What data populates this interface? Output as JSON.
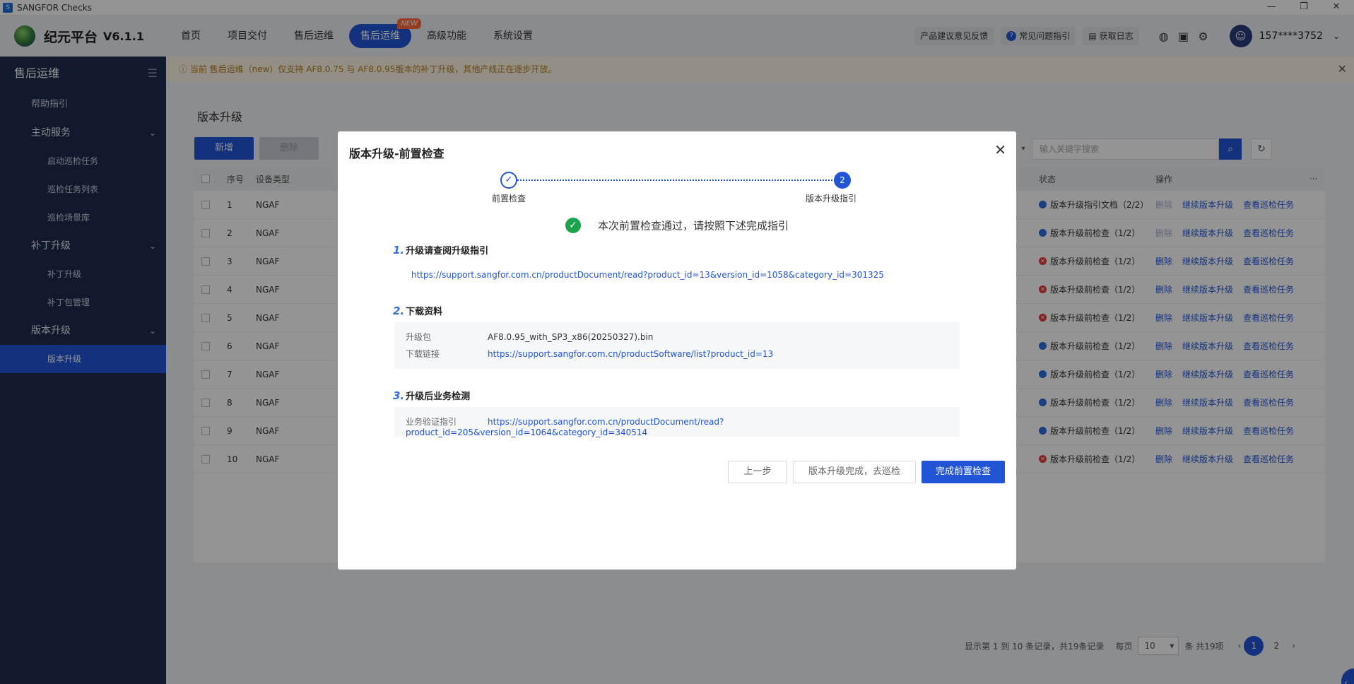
{
  "window": {
    "title": "SANGFOR Checks",
    "min": "—",
    "restore": "❐",
    "close": "✕",
    "app_icon": "S"
  },
  "topnav": {
    "brand": "纪元平台",
    "version": "V6.1.1",
    "items": [
      {
        "label": "首页"
      },
      {
        "label": "项目交付"
      },
      {
        "label": "售后运维"
      },
      {
        "label": "售后运维",
        "badge": "NEW"
      },
      {
        "label": "高级功能"
      },
      {
        "label": "系统设置"
      }
    ],
    "feedback": "产品建议意见反馈",
    "faq": "常见问题指引",
    "faq_icon_glyph": "?",
    "log": "获取日志",
    "log_icon_glyph": "▤",
    "globe_glyph": "◍",
    "chat_glyph": "▣",
    "gear_glyph": "⚙",
    "avatar_glyph": "☺",
    "chevron_glyph": "⌄",
    "user": "157****3752"
  },
  "sidebar": {
    "title": "售后运维",
    "menu_glyph": "☰",
    "arrow_glyph": "⌄",
    "help": "帮助指引",
    "groups": [
      {
        "label": "主动服务",
        "children": [
          "启动巡检任务",
          "巡检任务列表",
          "巡检场景库"
        ]
      },
      {
        "label": "补丁升级",
        "children": [
          "补丁升级",
          "补丁包管理"
        ]
      },
      {
        "label": "版本升级",
        "children": [
          "版本升级"
        ]
      }
    ]
  },
  "notice": {
    "text": "ⓘ  当前 售后运维（new）仅支持 AF8.0.75 与 AF8.0.95版本的补丁升级，其他产线正在逐步开放。",
    "close": "✕"
  },
  "page": {
    "title": "版本升级",
    "add": "新增",
    "delete": "删除",
    "search_placeholder": "输入关键字搜索",
    "search_glyph": "⌕",
    "refresh_glyph": "↻",
    "select_arrow": "▾",
    "more_glyph": "···",
    "columns": {
      "index": "序号",
      "type": "设备类型",
      "status": "状态",
      "ops": "操作"
    },
    "ops": {
      "delete": "删除",
      "continue": "继续版本升级",
      "view": "查看巡检任务"
    },
    "status_glyphs": {
      "blue": "●",
      "red": "✕"
    },
    "rows": [
      {
        "index": "1",
        "type": "NGAF",
        "status": "版本升级指引文档（2/2）",
        "color": "#2f6fe0",
        "delete_enabled": false
      },
      {
        "index": "2",
        "type": "NGAF",
        "status": "版本升级前检查（1/2）",
        "color": "#2f6fe0",
        "delete_enabled": false
      },
      {
        "index": "3",
        "type": "NGAF",
        "status": "版本升级前检查（1/2）",
        "color": "#e23c3c",
        "delete_enabled": true
      },
      {
        "index": "4",
        "type": "NGAF",
        "status": "版本升级前检查（1/2）",
        "color": "#e23c3c",
        "delete_enabled": true
      },
      {
        "index": "5",
        "type": "NGAF",
        "status": "版本升级前检查（1/2）",
        "color": "#e23c3c",
        "delete_enabled": true
      },
      {
        "index": "6",
        "type": "NGAF",
        "status": "版本升级前检查（1/2）",
        "color": "#2f6fe0",
        "delete_enabled": true
      },
      {
        "index": "7",
        "type": "NGAF",
        "status": "版本升级前检查（1/2）",
        "color": "#2f6fe0",
        "delete_enabled": true
      },
      {
        "index": "8",
        "type": "NGAF",
        "status": "版本升级前检查（1/2）",
        "color": "#2f6fe0",
        "delete_enabled": true
      },
      {
        "index": "9",
        "type": "NGAF",
        "status": "版本升级前检查（1/2）",
        "color": "#2f6fe0",
        "delete_enabled": true
      },
      {
        "index": "10",
        "type": "NGAF",
        "status": "版本升级前检查（1/2）",
        "color": "#e23c3c",
        "delete_enabled": true
      }
    ],
    "pager": {
      "summary": "显示第 1 到 10 条记录，共19条记录",
      "per_page_label": "每页",
      "per_page": "10",
      "per_page_arrow": "▾",
      "total": "条  共19项",
      "prev": "‹",
      "next": "›",
      "pages": [
        "1",
        "2"
      ]
    },
    "side_tab_glyph": "‹"
  },
  "modal": {
    "title": "版本升级-前置检查",
    "close": "✕",
    "step1_glyph": "✓",
    "step1": "前置检查",
    "step2_number": "2",
    "step2": "版本升级指引",
    "pass_glyph": "✓",
    "pass_text": "本次前置检查通过，请按照下述完成指引",
    "sections": [
      {
        "num": "1.",
        "title": "升级请查阅升级指引"
      },
      {
        "num": "2.",
        "title": "下载资料"
      },
      {
        "num": "3.",
        "title": "升级后业务检测"
      }
    ],
    "guide_link": "https://support.sangfor.com.cn/productDocument/read?product_id=13&version_id=1058&category_id=301325",
    "package_label": "升级包",
    "package_value": "AF8.0.95_with_SP3_x86(20250327).bin",
    "download_label": "下载链接",
    "download_link": "https://support.sangfor.com.cn/productSoftware/list?product_id=13",
    "verify_label": "业务验证指引",
    "verify_link": "https://support.sangfor.com.cn/productDocument/read?product_id=205&version_id=1064&category_id=340514",
    "buttons": {
      "prev": "上一步",
      "done_inspect": "版本升级完成，去巡检",
      "finish": "完成前置检查"
    }
  },
  "colors": {
    "primary": "#2155d6",
    "sidebar_bg": "#1e2d4d",
    "success": "#1aa34a",
    "error": "#e23c3c",
    "notice_text": "#b77c1e"
  }
}
